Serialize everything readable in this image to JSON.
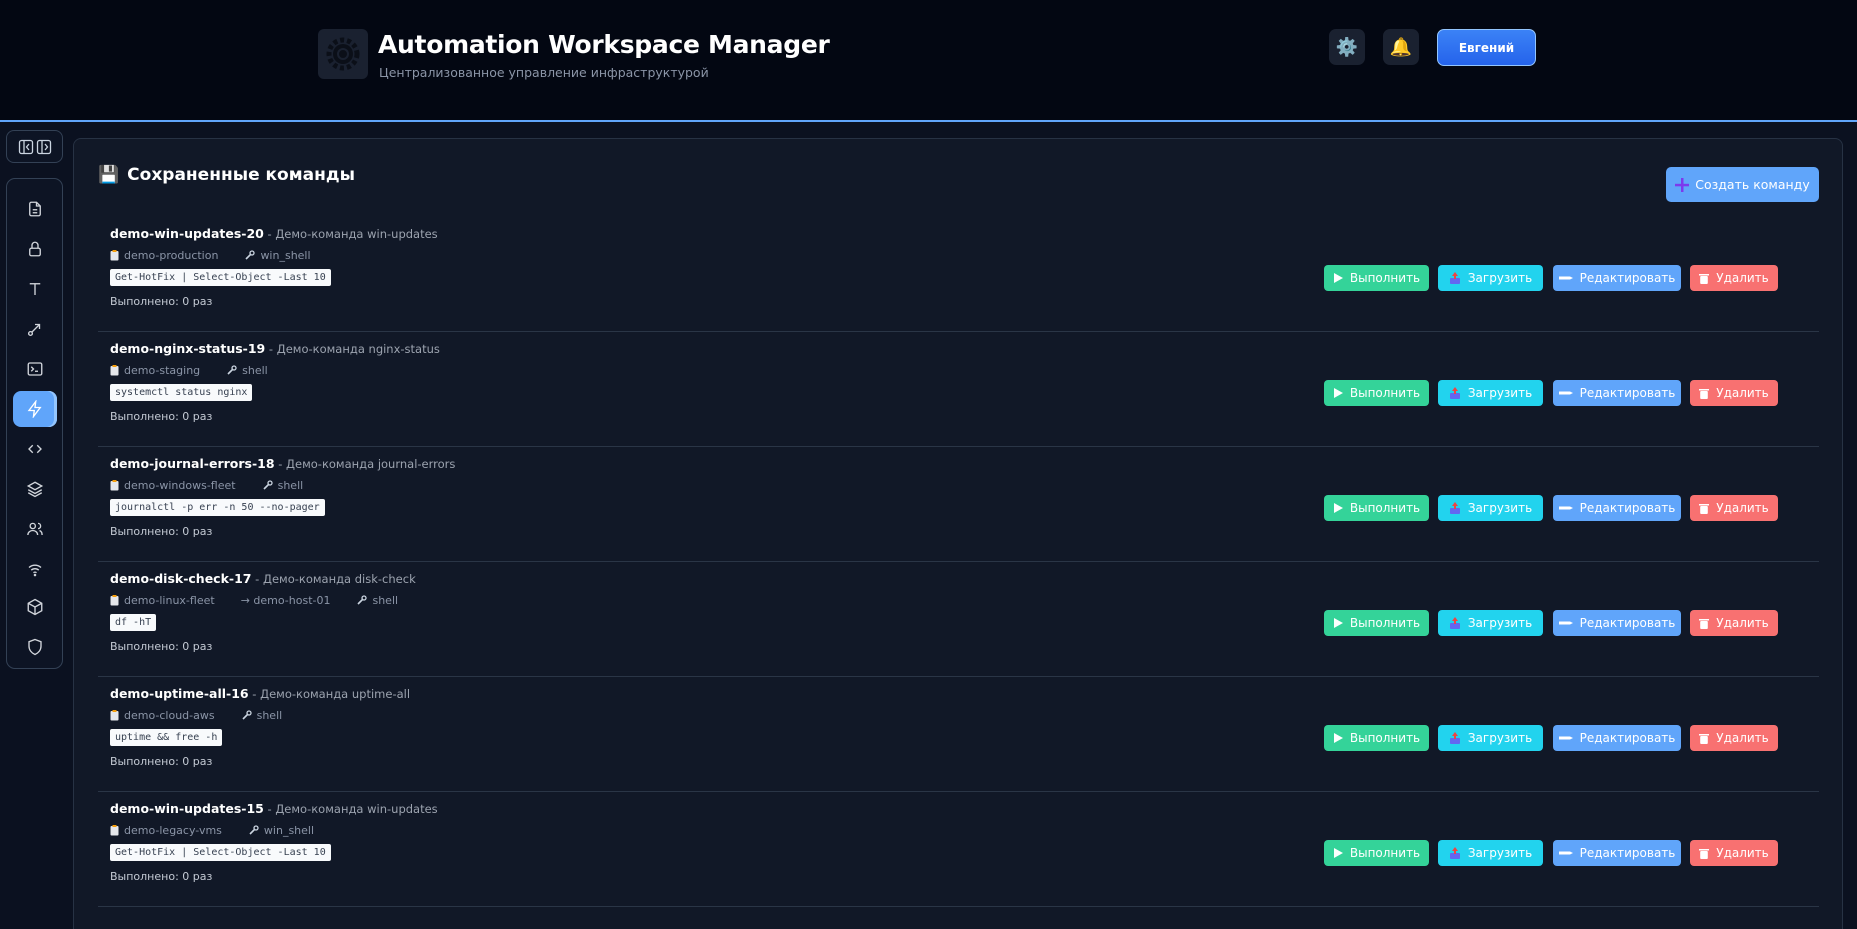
{
  "header": {
    "title": "Automation Workspace Manager",
    "subtitle": "Централизованное управление инфраструктурой",
    "settings_icon": "⚙️",
    "bell_icon": "🔔",
    "user_label": "Евгений"
  },
  "panel": {
    "title_icon": "💾",
    "title": "Сохраненные команды",
    "create_label": "Создать команду"
  },
  "buttons": {
    "run": "Выполнить",
    "load": "Загрузить",
    "edit": "Редактировать",
    "delete": "Удалить"
  },
  "commands": [
    {
      "name": "demo-win-updates-20",
      "desc": " - Демо-команда win-updates",
      "group": "demo-production",
      "host": "",
      "type": "win_shell",
      "code": "Get-HotFix | Select-Object -Last 10",
      "count": "Выполнено: 0 раз"
    },
    {
      "name": "demo-nginx-status-19",
      "desc": " - Демо-команда nginx-status",
      "group": "demo-staging",
      "host": "",
      "type": "shell",
      "code": "systemctl status nginx",
      "count": "Выполнено: 0 раз"
    },
    {
      "name": "demo-journal-errors-18",
      "desc": " - Демо-команда journal-errors",
      "group": "demo-windows-fleet",
      "host": "",
      "type": "shell",
      "code": "journalctl -p err -n 50 --no-pager",
      "count": "Выполнено: 0 раз"
    },
    {
      "name": "demo-disk-check-17",
      "desc": " - Демо-команда disk-check",
      "group": "demo-linux-fleet",
      "host": "→ demo-host-01",
      "type": "shell",
      "code": "df -hT",
      "count": "Выполнено: 0 раз"
    },
    {
      "name": "demo-uptime-all-16",
      "desc": " - Демо-команда uptime-all",
      "group": "demo-cloud-aws",
      "host": "",
      "type": "shell",
      "code": "uptime && free -h",
      "count": "Выполнено: 0 раз"
    },
    {
      "name": "demo-win-updates-15",
      "desc": " - Демо-команда win-updates",
      "group": "demo-legacy-vms",
      "host": "",
      "type": "win_shell",
      "code": "Get-HotFix | Select-Object -Last 10",
      "count": "Выполнено: 0 раз"
    }
  ],
  "sidebar": {
    "icons": [
      "file-icon",
      "lock-icon",
      "text-icon",
      "link-icon",
      "terminal-icon",
      "lightning-icon",
      "code-icon",
      "layers-icon",
      "users-icon",
      "wifi-icon",
      "box-icon",
      "shield-icon"
    ],
    "active_index": 5
  },
  "colors": {
    "accent": "#60a5fa",
    "run": "#34d399",
    "load": "#22d3ee",
    "edit": "#60a5fa",
    "delete": "#f87171"
  }
}
